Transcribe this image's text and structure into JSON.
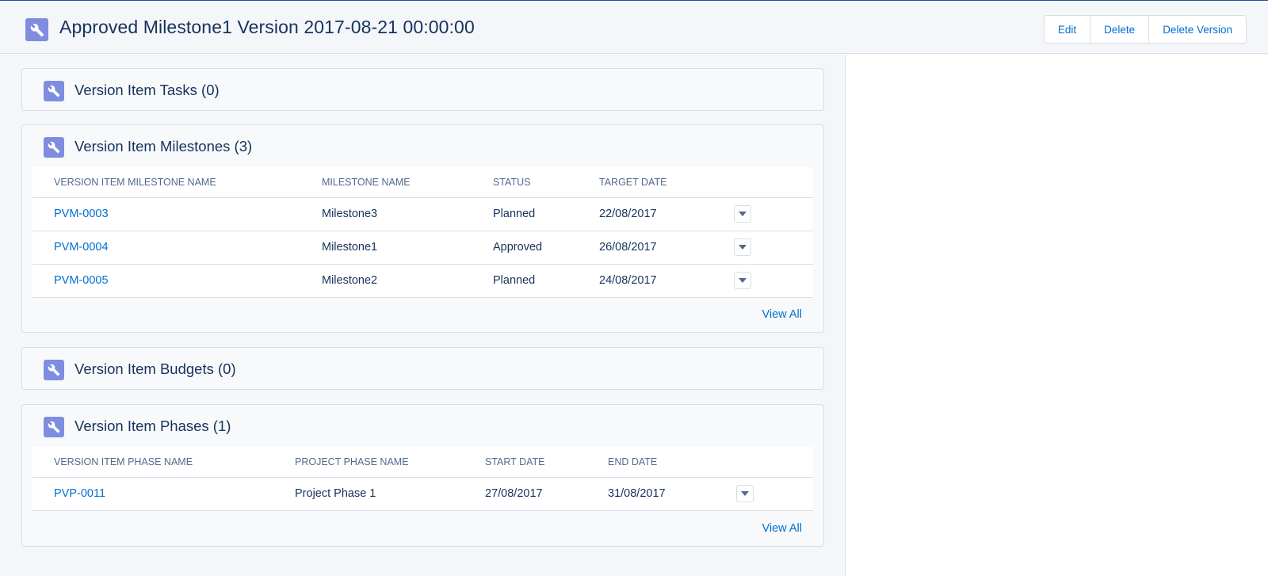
{
  "header": {
    "title": "Approved Milestone1 Version 2017-08-21 00:00:00",
    "icon": "wrench-icon",
    "buttons": {
      "edit": "Edit",
      "delete": "Delete",
      "delete_version": "Delete Version"
    }
  },
  "colors": {
    "accent": "#0070d2",
    "icon_bg": "#7f8de1",
    "text": "#16325c",
    "header_bg": "#f4f6f9"
  },
  "tasks": {
    "title": "Version Item Tasks (0)"
  },
  "milestones": {
    "title": "Version Item Milestones (3)",
    "columns": [
      "VERSION ITEM MILESTONE NAME",
      "MILESTONE NAME",
      "STATUS",
      "TARGET DATE"
    ],
    "rows": [
      {
        "name": "PVM-0003",
        "milestone": "Milestone3",
        "status": "Planned",
        "target_date": "22/08/2017"
      },
      {
        "name": "PVM-0004",
        "milestone": "Milestone1",
        "status": "Approved",
        "target_date": "26/08/2017"
      },
      {
        "name": "PVM-0005",
        "milestone": "Milestone2",
        "status": "Planned",
        "target_date": "24/08/2017"
      }
    ],
    "view_all": "View All"
  },
  "budgets": {
    "title": "Version Item Budgets (0)"
  },
  "phases": {
    "title": "Version Item Phases (1)",
    "columns": [
      "VERSION ITEM PHASE NAME",
      "PROJECT PHASE NAME",
      "START DATE",
      "END DATE"
    ],
    "rows": [
      {
        "name": "PVP-0011",
        "project_phase": "Project Phase 1",
        "start_date": "27/08/2017",
        "end_date": "31/08/2017"
      }
    ],
    "view_all": "View All"
  }
}
